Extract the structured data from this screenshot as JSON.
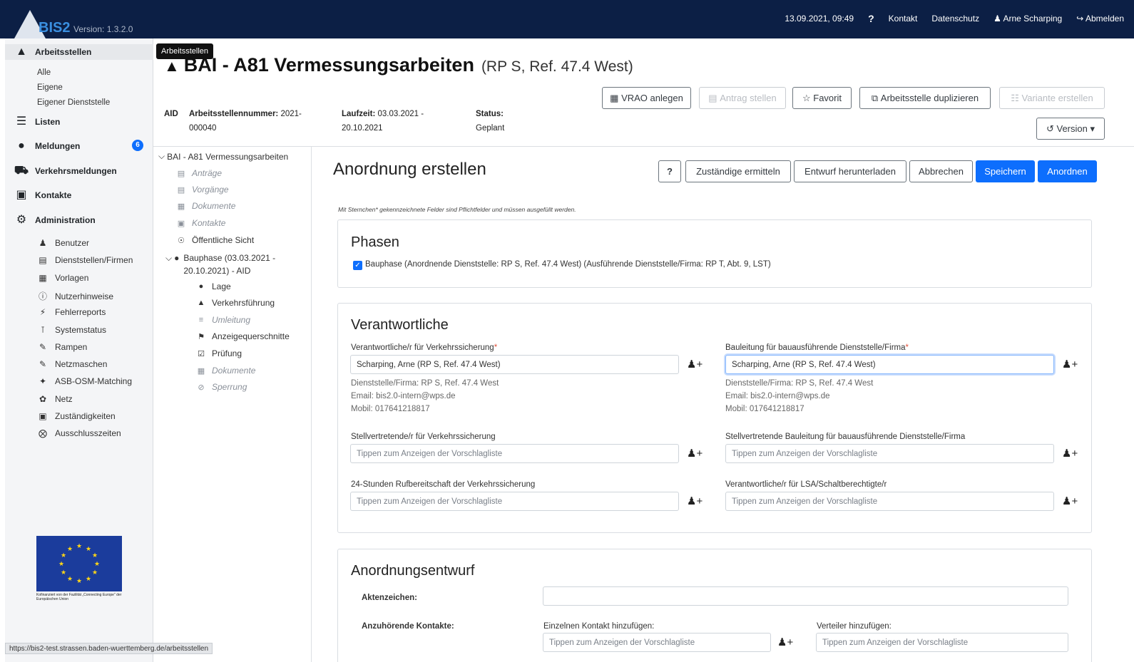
{
  "header": {
    "logo_text": "BIS2",
    "version": "Version: 1.3.2.0",
    "datetime": "13.09.2021, 09:49",
    "help": "?",
    "kontakt": "Kontakt",
    "datenschutz": "Datenschutz",
    "user": "Arne Scharping",
    "logout": "Abmelden"
  },
  "sidebar": {
    "arbeitsstellen": "Arbeitsstellen",
    "alle": "Alle",
    "eigene": "Eigene",
    "eigener_dienststelle": "Eigener Dienststelle",
    "listen": "Listen",
    "meldungen": "Meldungen",
    "meldungen_count": "6",
    "verkehrsmeldungen": "Verkehrsmeldungen",
    "kontakte": "Kontakte",
    "administration": "Administration",
    "admin_items": [
      "Benutzer",
      "Dienststellen/Firmen",
      "Vorlagen",
      "Nutzerhinweise",
      "Fehlerreports",
      "Systemstatus",
      "Rampen",
      "Netzmaschen",
      "ASB-OSM-Matching",
      "Netz",
      "Zuständigkeiten",
      "Ausschlusszeiten"
    ],
    "eu_text": "Kofinanziert von der Fazilität „Connecting Europe\" der Europäischen Union"
  },
  "tooltip": "Arbeitsstellen",
  "status_url": "https://bis2-test.strassen.baden-wuerttemberg.de/arbeitsstellen",
  "page": {
    "title": "BAI - A81 Vermessungsarbeiten",
    "subtitle": "(RP S, Ref. 47.4 West)",
    "aid": "AID",
    "nummer_label": "Arbeitsstellennummer:",
    "nummer_value": "2021-000040",
    "laufzeit_label": "Laufzeit:",
    "laufzeit_value": "03.03.2021 - 20.10.2021",
    "status_label": "Status:",
    "status_value": "Geplant",
    "buttons": {
      "vrao": "VRAO anlegen",
      "antrag": "Antrag stellen",
      "favorit": "Favorit",
      "duplizieren": "Arbeitsstelle duplizieren",
      "variante": "Variante erstellen",
      "version": "Version"
    }
  },
  "tree": {
    "root": "BAI - A81 Vermessungsarbeiten",
    "antraege": "Anträge",
    "vorgaenge": "Vorgänge",
    "dokumente": "Dokumente",
    "kontakte": "Kontakte",
    "oeffentlich": "Öffentliche Sicht",
    "bauphase": "Bauphase (03.03.2021 - 20.10.2021) - AID",
    "lage": "Lage",
    "verkehrsfuehrung": "Verkehrsführung",
    "umleitung": "Umleitung",
    "anzeige": "Anzeigequerschnitte",
    "pruefung": "Prüfung",
    "dokumente2": "Dokumente",
    "sperrung": "Sperrung"
  },
  "form": {
    "heading": "Anordnung erstellen",
    "buttons": {
      "help": "?",
      "zustaendige": "Zuständige ermitteln",
      "entwurf": "Entwurf herunterladen",
      "abbrechen": "Abbrechen",
      "speichern": "Speichern",
      "anordnen": "Anordnen"
    },
    "note": "Mit Sternchen* gekennzeichnete Felder sind Pflichtfelder und müssen ausgefüllt werden.",
    "phasen": {
      "title": "Phasen",
      "bauphase": "Bauphase (Anordnende Dienststelle: RP S, Ref. 47.4 West) (Ausführende Dienststelle/Firma: RP T, Abt. 9, LST)",
      "checked": true
    },
    "verantwortliche": {
      "title": "Verantwortliche",
      "v1_label": "Verantwortliche/r für Verkehrssicherung",
      "v1_value": "Scharping, Arne (RP S, Ref. 47.4 West)",
      "v1_info": [
        "Dienststelle/Firma: RP S, Ref. 47.4 West",
        "Email: bis2.0-intern@wps.de",
        "Mobil: 017641218817"
      ],
      "v2_label": "Bauleitung für bauausführende Dienststelle/Firma",
      "v2_value": "Scharping, Arne (RP S, Ref. 47.4 West)",
      "v2_info": [
        "Dienststelle/Firma: RP S, Ref. 47.4 West",
        "Email: bis2.0-intern@wps.de",
        "Mobil: 017641218817"
      ],
      "s1_label": "Stellvertretende/r für Verkehrssicherung",
      "s2_label": "Stellvertretende Bauleitung für bauausführende Dienststelle/Firma",
      "r1_label": "24-Stunden Rufbereitschaft der Verkehrssicherung",
      "r2_label": "Verantwortliche/r für LSA/Schaltberechtigte/r",
      "placeholder": "Tippen zum Anzeigen der Vorschlagliste"
    },
    "entwurf": {
      "title": "Anordnungsentwurf",
      "aktenzeichen": "Aktenzeichen:",
      "aktenzeichen_value": "",
      "kontakte": "Anzuhörende Kontakte:",
      "einzeln": "Einzelnen Kontakt hinzufügen:",
      "verteiler": "Verteiler hinzufügen:",
      "placeholder": "Tippen zum Anzeigen der Vorschlagliste"
    }
  }
}
